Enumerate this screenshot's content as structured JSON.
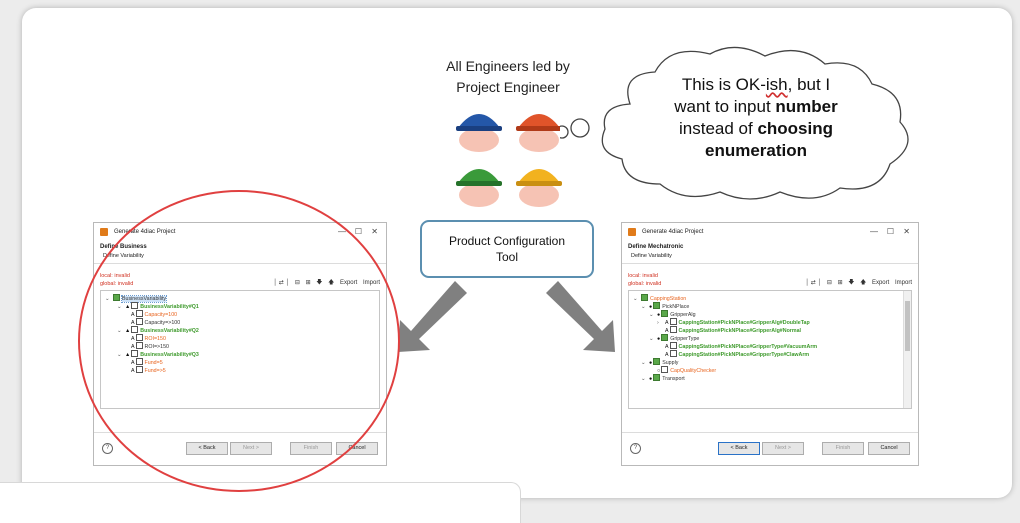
{
  "engineers_label": [
    "All Engineers led by",
    "Project Engineer"
  ],
  "speech": {
    "line1_pre": "This is OK-",
    "line1_squig": "ish",
    "line1_post": ", but I",
    "line2_pre": "want to input ",
    "line2_bold": "number",
    "line3_pre": "instead of ",
    "line3_bold": "choosing",
    "line4_bold": "enumeration"
  },
  "tool_box": [
    "Product Configuration",
    "Tool"
  ],
  "colors": {
    "accent_blue": "#5b8fb0",
    "invalid_red": "#d03020",
    "green_item": "#3e9a2c",
    "orange_item": "#e8641e",
    "highlight_circle": "#e04040"
  },
  "left_window": {
    "title": "Generate 4diac Project",
    "heading": "Define Business",
    "subheading": "Define Variability",
    "status_local": "local: invalid",
    "status_global": "global: invalid",
    "toolbar": {
      "export": "Export",
      "import": "Import"
    },
    "tree": [
      {
        "text": "BusinessVariability",
        "style": "k sel",
        "chev": "v",
        "marker": "",
        "box": "green"
      },
      {
        "text": "BusinessVariability#Q1",
        "style": "g",
        "chev": "v",
        "marker": "▲",
        "box": "plain"
      },
      {
        "text": "Capacity=100",
        "style": "o",
        "chev": "",
        "marker": "A",
        "box": "plain"
      },
      {
        "text": "Capacity=>100",
        "style": "k",
        "chev": "",
        "marker": "A",
        "box": "plain"
      },
      {
        "text": "BusinessVariability#Q2",
        "style": "g",
        "chev": "v",
        "marker": "▲",
        "box": "plain"
      },
      {
        "text": "ROI=150",
        "style": "o",
        "chev": "",
        "marker": "A",
        "box": "plain"
      },
      {
        "text": "ROI=>150",
        "style": "k",
        "chev": "",
        "marker": "A",
        "box": "plain"
      },
      {
        "text": "BusinessVariability#Q3",
        "style": "g",
        "chev": "v",
        "marker": "▲",
        "box": "plain"
      },
      {
        "text": "Fund=5",
        "style": "o",
        "chev": "",
        "marker": "A",
        "box": "plain"
      },
      {
        "text": "Fund=>5",
        "style": "o",
        "chev": "",
        "marker": "A",
        "box": "plain"
      }
    ],
    "buttons": {
      "back": "< Back",
      "next": "Next >",
      "finish": "Finish",
      "cancel": "Cancel"
    }
  },
  "right_window": {
    "title": "Generate 4diac Project",
    "heading": "Define Mechatronic",
    "subheading": "Define Variability",
    "status_local": "local: invalid",
    "status_global": "global: invalid",
    "toolbar": {
      "export": "Export",
      "import": "Import"
    },
    "tree": [
      {
        "text": "CappingStation",
        "style": "o",
        "chev": "v",
        "marker": "",
        "box": "green"
      },
      {
        "text": "PickNPlace",
        "style": "k",
        "chev": "v",
        "marker": "●",
        "box": "green"
      },
      {
        "text": "GripperAlg",
        "style": "k",
        "chev": "v",
        "marker": "●",
        "box": "green"
      },
      {
        "text": "CappingStation#PickNPlace#GripperAlg#DoubleTap",
        "style": "g",
        "chev": ">",
        "marker": "A",
        "box": "plain"
      },
      {
        "text": "CappingStation#PickNPlace#GripperAlg#Normal",
        "style": "g",
        "chev": "",
        "marker": "A",
        "box": "plain"
      },
      {
        "text": "GripperType",
        "style": "k",
        "chev": "v",
        "marker": "●",
        "box": "green"
      },
      {
        "text": "CappingStation#PickNPlace#GripperType#VacuumArm",
        "style": "g",
        "chev": "",
        "marker": "A",
        "box": "plain"
      },
      {
        "text": "CappingStation#PickNPlace#GripperType#ClawArm",
        "style": "g",
        "chev": "",
        "marker": "A",
        "box": "plain"
      },
      {
        "text": "Supply",
        "style": "k",
        "chev": "v",
        "marker": "●",
        "box": "green"
      },
      {
        "text": "CapQualityChecker",
        "style": "o",
        "chev": "",
        "marker": "○",
        "box": "plain"
      },
      {
        "text": "Transport",
        "style": "k",
        "chev": "v",
        "marker": "●",
        "box": "green"
      }
    ],
    "buttons": {
      "back": "< Back",
      "next": "Next >",
      "finish": "Finish",
      "cancel": "Cancel"
    }
  }
}
